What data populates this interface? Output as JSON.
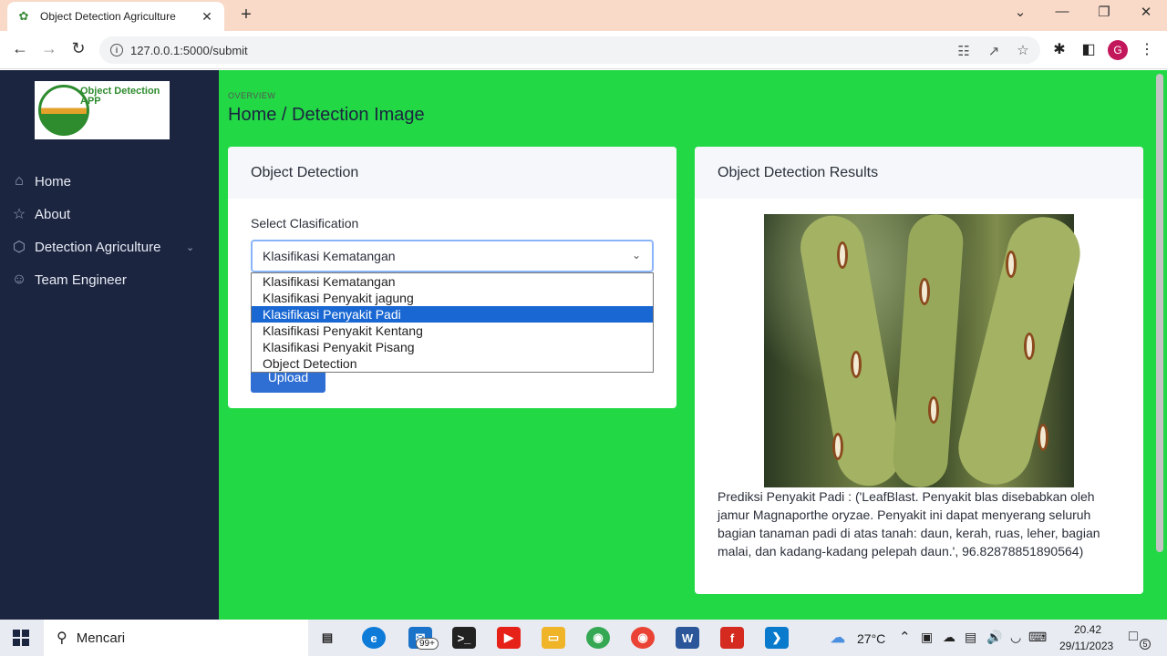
{
  "browser": {
    "tab_title": "Object Detection Agriculture",
    "url": "127.0.0.1:5000/submit",
    "profile_initial": "G"
  },
  "sidebar": {
    "logo_text": "Object Detection APP",
    "items": [
      {
        "label": "Home",
        "icon": "home-icon"
      },
      {
        "label": "About",
        "icon": "star-icon"
      },
      {
        "label": "Detection Agriculture",
        "icon": "cube-icon"
      },
      {
        "label": "Team Engineer",
        "icon": "users-icon"
      }
    ]
  },
  "header": {
    "overline": "OVERVIEW",
    "title": "Home / Detection Image"
  },
  "detection_card": {
    "title": "Object Detection",
    "select_label": "Select Clasification",
    "selected_value": "Klasifikasi Kematangan",
    "options": [
      "Klasifikasi Kematangan",
      "Klasifikasi Penyakit jagung",
      "Klasifikasi Penyakit Padi",
      "Klasifikasi Penyakit Kentang",
      "Klasifikasi Penyakit Pisang",
      "Object Detection"
    ],
    "highlighted_option": "Klasifikasi Penyakit Padi",
    "upload_label": "Upload"
  },
  "results_card": {
    "title": "Object Detection Results",
    "prediction": "Prediksi Penyakit Padi : ('LeafBlast. Penyakit blas disebabkan oleh jamur Magnaporthe oryzae. Penyakit ini dapat menyerang seluruh bagian tanaman padi di atas tanah: daun, kerah, ruas, leher, bagian malai, dan kadang-kadang pelepah daun.', 96.82878851890564)"
  },
  "taskbar": {
    "search_placeholder": "Mencari",
    "mail_badge": "99+",
    "weather": "27°C",
    "time": "20.42",
    "date": "29/11/2023",
    "notification_count": "5"
  },
  "colors": {
    "page_bg": "#22d845",
    "sidebar_bg": "#1c2540",
    "upload_button": "#2f6fd4",
    "highlight": "#1967d2"
  }
}
